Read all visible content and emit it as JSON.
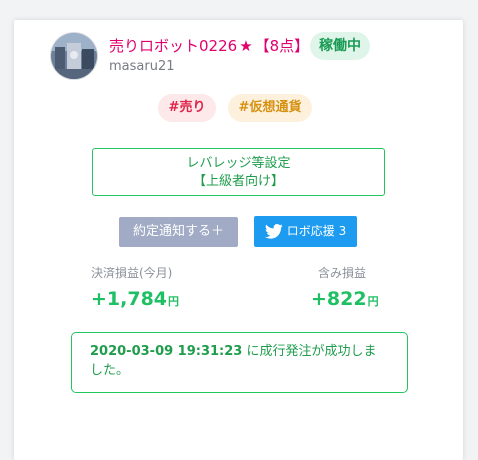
{
  "robot": {
    "name": "売りロボット0226",
    "rank": "【8点】",
    "status": "稼働中",
    "username": "masaru21"
  },
  "tags": [
    "#売り",
    "#仮想通貨"
  ],
  "leverage_button": {
    "line1": "レバレッジ等設定",
    "line2": "【上級者向け】"
  },
  "buttons": {
    "notify": "約定通知する＋",
    "support": "ロボ応援 3"
  },
  "stats": {
    "settled_label": "決済損益(今月)",
    "settled_value": "+1,784",
    "unrealized_label": "含み損益",
    "unrealized_value": "+822",
    "unit": "円"
  },
  "message": {
    "timestamp": "2020-03-09 19:31:23",
    "text": " に成行発注が成功しました。"
  },
  "colors": {
    "accent_pink": "#e0006e",
    "green": "#1fbf63",
    "twitter_blue": "#1d9bf0"
  },
  "icons": {
    "avatar": "avatar-photo",
    "star": "star-icon",
    "twitter": "twitter-bird-icon"
  }
}
